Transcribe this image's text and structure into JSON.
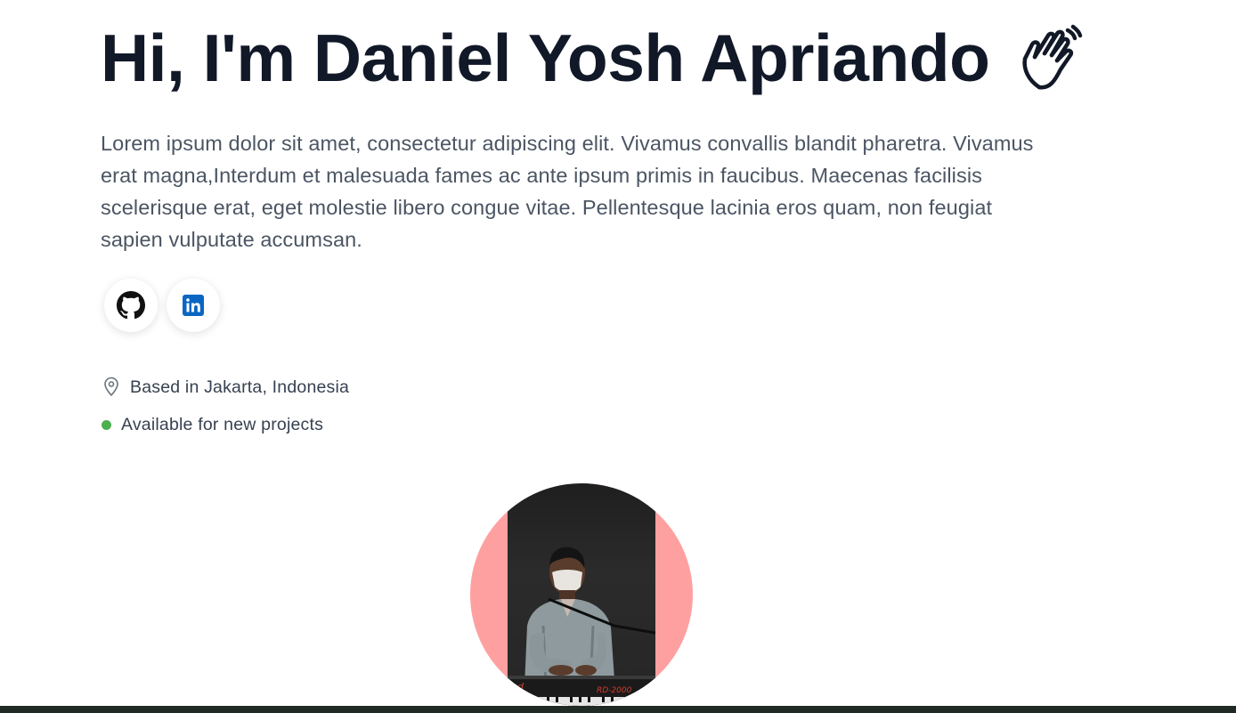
{
  "hero": {
    "title": "Hi, I'm Daniel Yosh Apriando",
    "intro": "Lorem ipsum dolor sit amet, consectetur adipiscing elit. Vivamus convallis blandit pharetra. Vivamus erat magna,Interdum et malesuada fames ac ante ipsum primis in faucibus. Maecenas facilisis scelerisque erat, eget molestie libero congue vitae. Pellentesque lacinia eros quam, non feugiat sapien vulputate accumsan."
  },
  "socials": [
    {
      "icon": "github-icon"
    },
    {
      "icon": "linkedin-icon",
      "color": "#0a66c2"
    }
  ],
  "meta": {
    "location": "Based in Jakarta, Indonesia",
    "status": "Available for new projects",
    "status_color": "#4caf50"
  },
  "colors": {
    "title": "#111827",
    "body": "#4b5563",
    "avatar_bg": "#ffa0a0"
  }
}
